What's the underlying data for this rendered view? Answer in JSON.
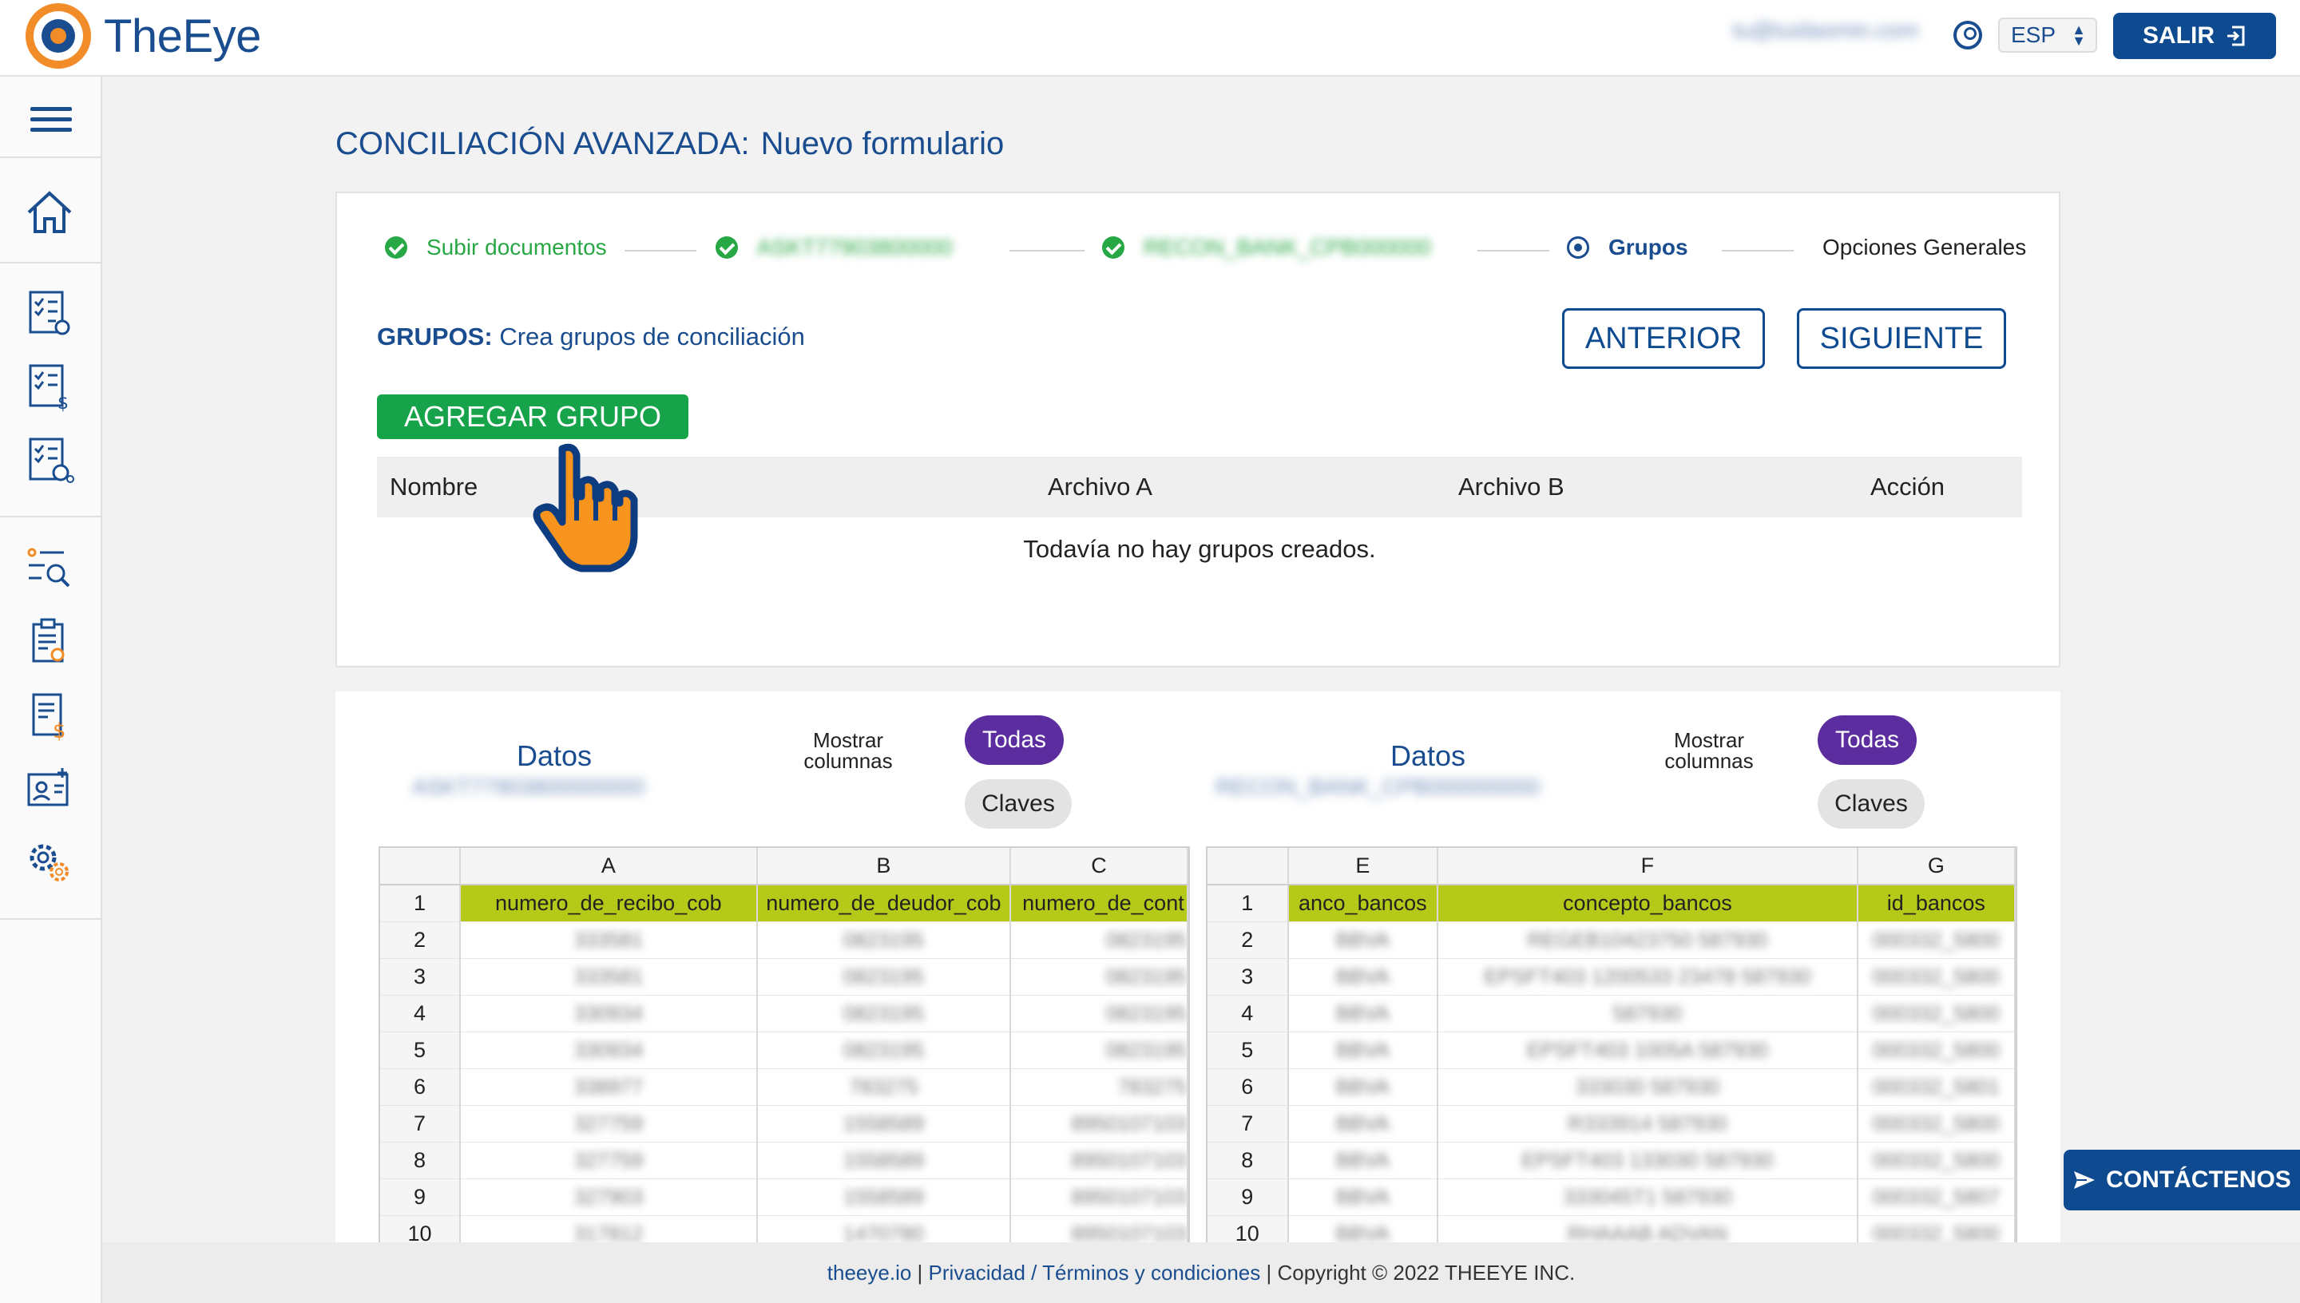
{
  "app": {
    "name": "TheEye"
  },
  "header": {
    "user_email": "tu@tuidasmin.com",
    "language": "ESP",
    "logout_label": "SALIR"
  },
  "page": {
    "title": "CONCILIACIÓN AVANZADA:",
    "subtitle": "Nuevo formulario"
  },
  "stepper": {
    "steps": [
      {
        "label": "Subir documentos",
        "state": "done"
      },
      {
        "label": "ASKT77903800000",
        "state": "done"
      },
      {
        "label": "RECON_BANK_CPB000000",
        "state": "done"
      },
      {
        "label": "Grupos",
        "state": "current"
      },
      {
        "label": "Opciones Generales",
        "state": "pending"
      }
    ]
  },
  "groups": {
    "label_bold": "GRUPOS:",
    "label_text": "Crea grupos de conciliación",
    "prev_button": "ANTERIOR",
    "next_button": "SIGUIENTE",
    "add_button": "AGREGAR GRUPO",
    "columns": [
      "Nombre",
      "Archivo A",
      "Archivo B",
      "Acción"
    ],
    "empty_message": "Todavía no hay grupos creados."
  },
  "data_panels": [
    {
      "title": "Datos",
      "file_name": "ASKT77903800000000",
      "show_columns_label": "Mostrar columnas",
      "filter_all": "Todas",
      "filter_keys": "Claves",
      "column_letters": [
        "A",
        "B",
        "C"
      ],
      "fields": [
        "numero_de_recibo_cob",
        "numero_de_deudor_cob",
        "numero_de_cont"
      ],
      "row_numbers": [
        "1",
        "2",
        "3",
        "4",
        "5",
        "6",
        "7",
        "8",
        "9",
        "10"
      ],
      "rows": [
        [
          "333581",
          "0823195",
          "0823195"
        ],
        [
          "333581",
          "0823195",
          "0823195"
        ],
        [
          "330934",
          "0823195",
          "0823195"
        ],
        [
          "330934",
          "0823195",
          "0823195"
        ],
        [
          "338977",
          "783275",
          "783275"
        ],
        [
          "327759",
          "1558589",
          "8950107103"
        ],
        [
          "327759",
          "1558589",
          "8950107103"
        ],
        [
          "327903",
          "1558589",
          "8950107103"
        ],
        [
          "317812",
          "1470780",
          "8950107103"
        ]
      ]
    },
    {
      "title": "Datos",
      "file_name": "RECON_BANK_CPB000000000",
      "show_columns_label": "Mostrar columnas",
      "filter_all": "Todas",
      "filter_keys": "Claves",
      "column_letters": [
        "E",
        "F",
        "G"
      ],
      "fields": [
        "anco_bancos",
        "concepto_bancos",
        "id_bancos"
      ],
      "row_numbers": [
        "1",
        "2",
        "3",
        "4",
        "5",
        "6",
        "7",
        "8",
        "9",
        "10"
      ],
      "rows": [
        [
          "BBVA",
          "REGEB10423750    587930",
          "000332_5800"
        ],
        [
          "BBVA",
          "EPSFT403 1200533 23478    587930",
          "000332_5800"
        ],
        [
          "BBVA",
          "587930",
          "000332_5800"
        ],
        [
          "BBVA",
          "EPSFT403 1005A    587930",
          "000332_5800"
        ],
        [
          "BBVA",
          "333030    587930",
          "000332_5801"
        ],
        [
          "BBVA",
          "R333914    587930",
          "000332_5800"
        ],
        [
          "BBVA",
          "EPSFT403 133030    587930",
          "000332_5800"
        ],
        [
          "BBVA",
          "333045T1    587930",
          "000332_5807"
        ],
        [
          "BBVA",
          "RHAAAB    ADVAN",
          "000332_5800"
        ]
      ]
    }
  ],
  "footer": {
    "site": "theeye.io",
    "privacy": "Privacidad",
    "terms": "Términos y condiciones",
    "copyright": "Copyright © 2022 THEEYE INC."
  },
  "contact_button": "CONTÁCTENOS",
  "colors": {
    "brand_blue": "#0d4a8f",
    "brand_orange": "#f28c28",
    "success_green": "#16a34a",
    "pill_purple": "#5b2d9e",
    "field_row_olive": "#b5c918"
  }
}
